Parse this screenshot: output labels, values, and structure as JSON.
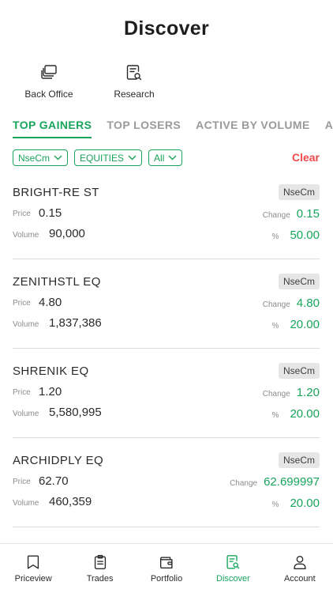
{
  "header": {
    "title": "Discover"
  },
  "quick_links": [
    {
      "label": "Back Office",
      "icon": "stacked-cards-icon"
    },
    {
      "label": "Research",
      "icon": "document-search-icon"
    }
  ],
  "tabs": [
    {
      "label": "TOP GAINERS",
      "active": true
    },
    {
      "label": "TOP LOSERS",
      "active": false
    },
    {
      "label": "ACTIVE BY VOLUME",
      "active": false
    },
    {
      "label": "A",
      "active": false
    }
  ],
  "filters": {
    "exchange": "NseCm",
    "segment": "EQUITIES",
    "scope": "All",
    "clear_label": "Clear"
  },
  "labels": {
    "price": "Price",
    "volume": "Volume",
    "change": "Change",
    "percent": "%"
  },
  "stocks": [
    {
      "symbol": "BRIGHT-RE ST",
      "exchange": "NseCm",
      "price": "0.15",
      "volume": "90,000",
      "change": "0.15",
      "percent": "50.00"
    },
    {
      "symbol": "ZENITHSTL EQ",
      "exchange": "NseCm",
      "price": "4.80",
      "volume": "1,837,386",
      "change": "4.80",
      "percent": "20.00"
    },
    {
      "symbol": "SHRENIK EQ",
      "exchange": "NseCm",
      "price": "1.20",
      "volume": "5,580,995",
      "change": "1.20",
      "percent": "20.00"
    },
    {
      "symbol": "ARCHIDPLY EQ",
      "exchange": "NseCm",
      "price": "62.70",
      "volume": "460,359",
      "change": "62.699997",
      "percent": "20.00"
    }
  ],
  "bottom_nav": [
    {
      "label": "Priceview",
      "icon": "bookmark-icon",
      "active": false
    },
    {
      "label": "Trades",
      "icon": "clipboard-icon",
      "active": false
    },
    {
      "label": "Portfolio",
      "icon": "wallet-icon",
      "active": false
    },
    {
      "label": "Discover",
      "icon": "document-search-icon",
      "active": true
    },
    {
      "label": "Account",
      "icon": "user-icon",
      "active": false
    }
  ],
  "colors": {
    "accent": "#18a55b",
    "danger": "#ee4a4a",
    "muted": "#9a9a9a"
  }
}
